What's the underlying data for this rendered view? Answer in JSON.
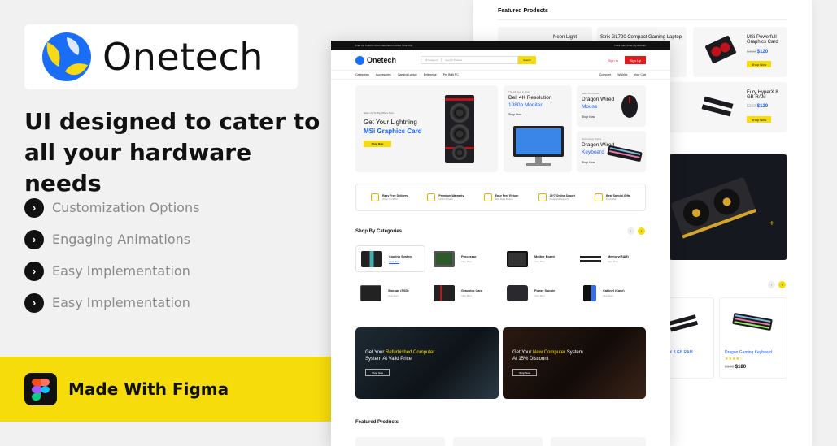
{
  "brand": {
    "name": "Onetech"
  },
  "tagline": "UI designed to cater to all your hardware needs",
  "features": [
    "Customization Options",
    "Engaging Animations",
    "Easy Implementation",
    "Easy Implementation"
  ],
  "figma_bar": {
    "label": "Made With Figma"
  },
  "colors": {
    "accent": "#f5dc0a",
    "blue": "#1a6ef5",
    "red": "#e21c1c",
    "dark": "#111111"
  },
  "back_card": {
    "title": "Featured Products",
    "products": [
      {
        "name": "Neon Light"
      },
      {
        "name": "Strix GL720 Compact Gaming Laptop"
      },
      {
        "name": "MSi Powerfull Graphics Card",
        "old_price": "$150",
        "price": "$120",
        "btn": "Shop Now"
      },
      {
        "name": "Fury HyperX 8 GB RAM",
        "old_price": "$150",
        "price": "$120",
        "btn": "Shop Now"
      },
      {
        "name": "X 8 GB RAM"
      },
      {
        "name": "Dragon Gaming Keyboard",
        "old_price": "$150",
        "price": "$180"
      }
    ]
  },
  "screen": {
    "topbar_left": "Free Up To 30% Off on New Items Limited Time Only",
    "topbar_right": "Track Your Order   My Account",
    "search_placeholder": "Search Product",
    "search_category": "All Category",
    "search_button": "Search",
    "signin": "Sign In",
    "signup": "Sign Up",
    "nav": [
      "Categories",
      "Accessories",
      "Gaming Laptop",
      "Enterprise",
      "Pre Built PC"
    ],
    "nav_right": [
      "Compare",
      "Wishlist",
      "Your Cart"
    ],
    "hero": {
      "sub": "Save Up To Top Offers Now",
      "line1": "Get Your Lightning",
      "line2": "MSi Graphics Card",
      "button": "Shop Now"
    },
    "panel_monitor": {
      "small": "The All New in Town",
      "line1": "Dell 4K Resolution",
      "line2": "1080p Moniter",
      "link": "Shop Now"
    },
    "panel_mouse": {
      "small": "Save Top Quality",
      "line1": "Dragon Wired",
      "line2": "Mouse",
      "link": "Shop Now"
    },
    "panel_keyboard": {
      "small": "Technology Styles",
      "line1": "Dragon Wired",
      "line2": "Keyboard",
      "link": "Shop Now"
    },
    "features_strip": [
      {
        "title": "Easy Free Delivery",
        "sub": "Order On $500"
      },
      {
        "title": "Premium Warranty",
        "sub": "Up To 2 Years"
      },
      {
        "title": "Easy Free Return",
        "sub": "With Days Return"
      },
      {
        "title": "24*7 Online Suport",
        "sub": "Dedicated Supports"
      },
      {
        "title": "Best Special Gifts",
        "sub": "Find Offers"
      }
    ],
    "categories_title": "Shop By Categories",
    "categories": [
      {
        "name": "Cooling System",
        "sub": "View More"
      },
      {
        "name": "Processor",
        "sub": "View More"
      },
      {
        "name": "Mother Board",
        "sub": "View More"
      },
      {
        "name": "Memory(RAM)",
        "sub": "View More"
      },
      {
        "name": "Storage (SSD)",
        "sub": "View More"
      },
      {
        "name": "Graphics Card",
        "sub": "View More"
      },
      {
        "name": "Power Supply",
        "sub": "View More"
      },
      {
        "name": "Cabinet (Case)",
        "sub": "View More"
      }
    ],
    "promo_left": {
      "pre": "Get Your ",
      "hl": "Refurbished Computer",
      "line2": "System At Valid Price",
      "btn": "Shop Now"
    },
    "promo_right": {
      "pre": "Get Your ",
      "hl": "New Computer",
      "post": " System",
      "line2": "At 15% Discount",
      "btn": "Shop Now"
    },
    "featured_title": "Featured Products"
  }
}
